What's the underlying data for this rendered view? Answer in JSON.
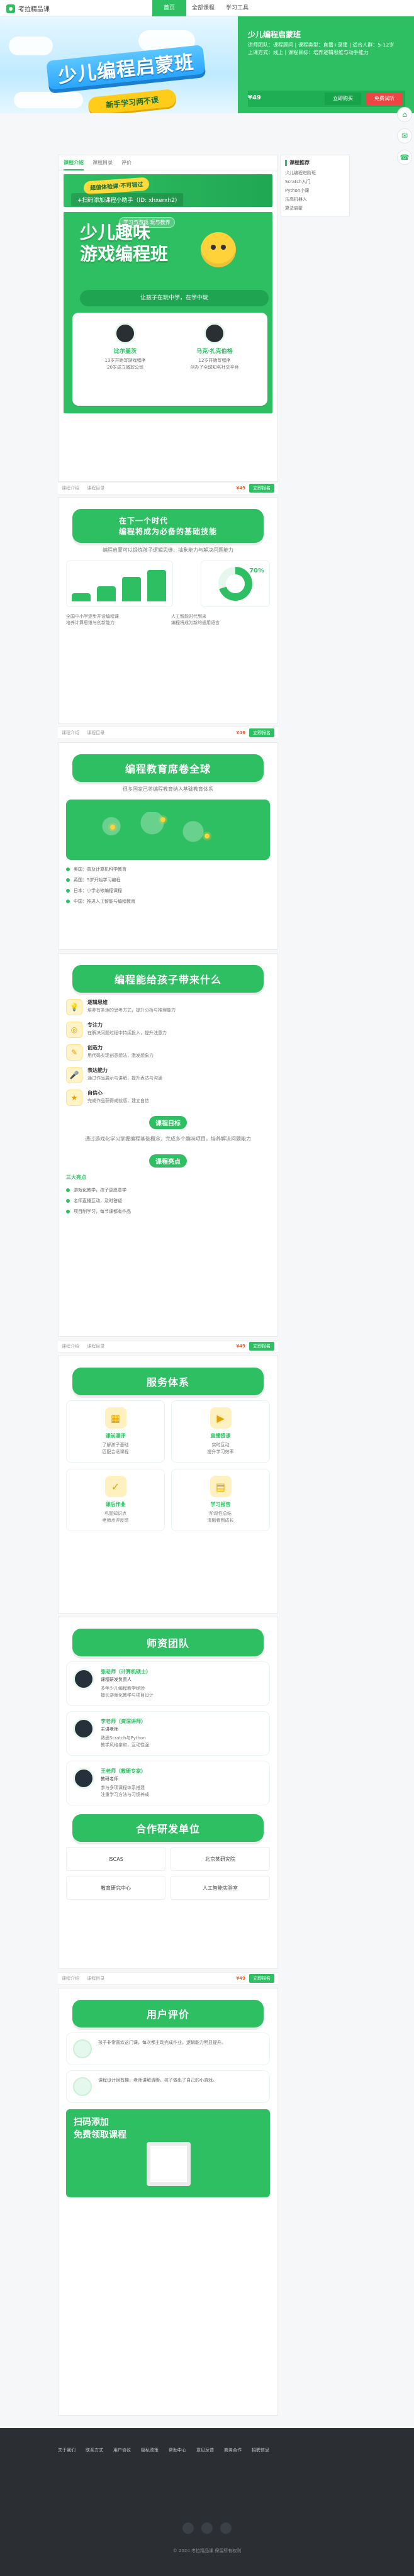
{
  "header": {
    "brand": "考拉精品课",
    "nav": [
      "首页",
      "全部课程",
      "学习工具"
    ],
    "active_index": 0
  },
  "hero": {
    "title": "少儿编程启蒙班",
    "subtitle": "新手学习两不误",
    "panel_title": "少儿编程启蒙班",
    "panel_meta": "讲师团队：课程顾问 | 课程类型：直播+录播 | 适合人群：5-12岁\n上课方式：线上 | 课程目标：培养逻辑思维与动手能力",
    "price": "¥49",
    "btn_buy": "立即购买",
    "btn_free": "免费试听"
  },
  "sidebar": {
    "title": "课程推荐",
    "items": [
      "少儿编程进阶班",
      "Scratch入门",
      "Python小课",
      "乐高机器人",
      "算法启蒙"
    ]
  },
  "tabs": {
    "items": [
      "课程介绍",
      "课程目录",
      "评价"
    ],
    "active": 0
  },
  "promo": {
    "tag": "超值体验课·不可错过",
    "line": "+扫码添加课程小助手（ID: xhxerxh2)"
  },
  "poster": {
    "badge": "学习与游戏  玩与教养",
    "headline_1": "少儿趣味",
    "headline_2": "游戏编程班",
    "ribbon": "让孩子在玩中学，在学中玩",
    "p1_name": "比尔盖茨",
    "p1_desc": "13岁开始写游戏程序\n20岁成立微软公司",
    "p2_name": "马克·扎克伯格",
    "p2_desc": "12岁开始写程序\n创办了全球知名社交平台"
  },
  "cta": {
    "left_a": "课程介绍",
    "left_b": "课程目录",
    "amount": "¥49",
    "btn": "立即报名"
  },
  "section_why": {
    "title": "在下一个时代\n编程将成为必备的基础技能",
    "desc": "编程启蒙可以锻炼孩子逻辑思维、抽象能力与解决问题能力",
    "bars": [
      18,
      34,
      56,
      72
    ],
    "donut": 70,
    "note_left": "全国中小学逐步开设编程课\n培养计算思维与创新能力",
    "note_right": "人工智能时代到来\n编程将成为新的通用语言"
  },
  "section_world": {
    "title": "编程教育席卷全球",
    "desc": "很多国家已将编程教育纳入基础教育体系",
    "points": [
      "美国：普及计算机科学教育",
      "英国：5岁开始学习编程",
      "日本：小学必修编程课程",
      "中国：推进人工智能与编程教育"
    ]
  },
  "section_learn": {
    "title": "编程能给孩子带来什么",
    "items": [
      {
        "t": "逻辑思维",
        "d": "培养有条理的思考方式，提升分析与推理能力"
      },
      {
        "t": "专注力",
        "d": "在解决问题过程中持续投入，提升注意力"
      },
      {
        "t": "创造力",
        "d": "用代码实现创意想法，激发想象力"
      },
      {
        "t": "表达能力",
        "d": "通过作品展示与讲解，提升表达与沟通"
      },
      {
        "t": "自信心",
        "d": "完成作品获得成就感，建立自信"
      }
    ]
  },
  "section_goal": {
    "title": "课程目标",
    "desc": "通过游戏化学习掌握编程基础概念，完成多个趣味项目，培养解决问题能力"
  },
  "section_highlights": {
    "title": "课程亮点",
    "badge": "三大亮点",
    "items": [
      "游戏化教学，孩子更愿意学",
      "名师直播互动，及时答疑",
      "项目制学习，每节课都有作品"
    ]
  },
  "section_service": {
    "title": "服务体系",
    "tiles": [
      {
        "t": "课前测评",
        "d": "了解孩子基础\n匹配合适课程"
      },
      {
        "t": "直播授课",
        "d": "实时互动\n提升学习效率"
      },
      {
        "t": "课后作业",
        "d": "巩固知识点\n老师点评反馈"
      },
      {
        "t": "学习报告",
        "d": "阶段性总结\n清晰看到成长"
      }
    ]
  },
  "section_teachers": {
    "title": "师资团队",
    "list": [
      {
        "name": "张老师（计算机硕士）",
        "role": "课程研发负责人",
        "d": "多年少儿编程教学经验\n擅长游戏化教学与项目设计"
      },
      {
        "name": "李老师（资深讲师）",
        "role": "主讲老师",
        "d": "熟悉Scratch与Python\n教学风格亲和，互动性强"
      },
      {
        "name": "王老师（教研专家）",
        "role": "教研老师",
        "d": "参与多项课程体系搭建\n注重学习方法与习惯养成"
      }
    ]
  },
  "section_partners": {
    "title": "合作研发单位",
    "logos": [
      "ISCAS",
      "北京某研究院",
      "教育研究中心",
      "人工智能实验室"
    ]
  },
  "section_reviews": {
    "title": "用户评价",
    "items": [
      "孩子非常喜欢这门课，每次都主动完成作业，逻辑能力明显提升。",
      "课程设计很有趣，老师讲解清晰，孩子做出了自己的小游戏。"
    ]
  },
  "qr": {
    "caption": "扫码添加\n免费领取课程"
  },
  "footer": {
    "links": [
      "关于我们",
      "联系方式",
      "用户协议",
      "隐私政策",
      "帮助中心",
      "意见反馈",
      "商务合作",
      "招聘信息"
    ],
    "copy": "© 2024 考拉精品课  保留所有权利"
  },
  "colors": {
    "primary": "#2fbf63",
    "danger": "#ef4444",
    "accent": "#ffd23a"
  }
}
